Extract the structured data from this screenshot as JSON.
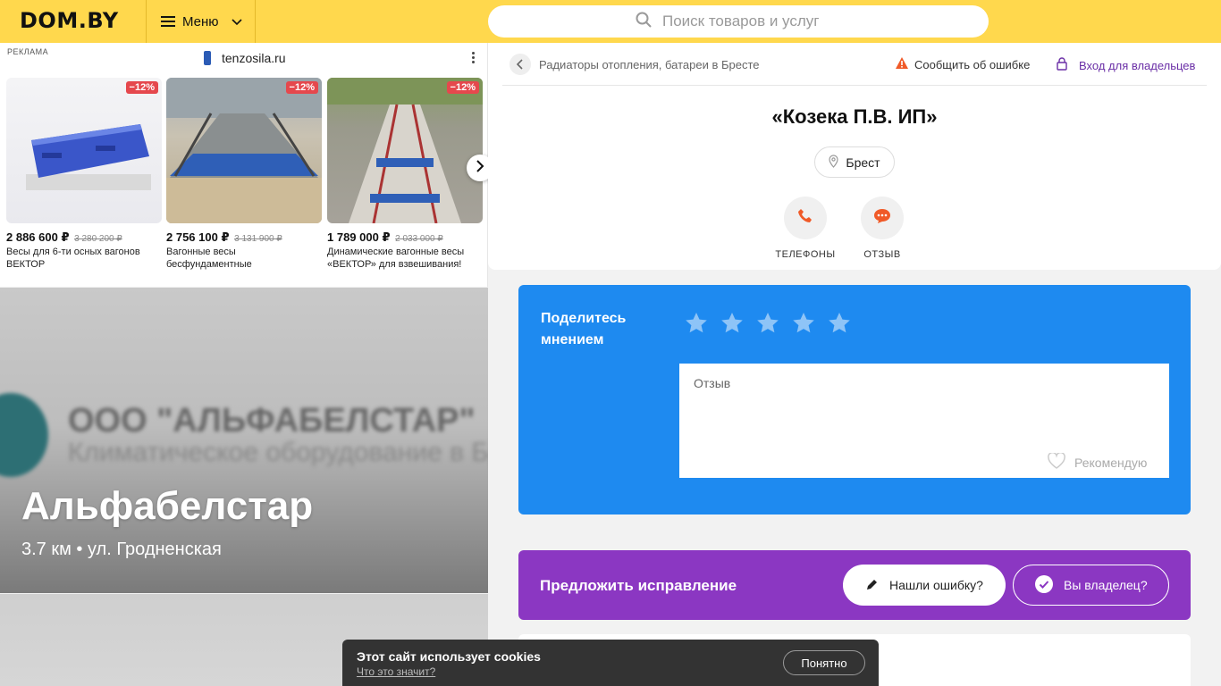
{
  "header": {
    "logo": "DOM.BY",
    "menu_label": "Меню",
    "search_placeholder": "Поиск товаров и услуг"
  },
  "ad": {
    "label": "РЕКЛАМА",
    "domain": "tenzosila.ru",
    "items": [
      {
        "badge": "−12%",
        "price": "2 886 600 ₽",
        "old_price": "3 280 200 ₽",
        "desc": "Весы для 6-ти осных вагонов ВЕКТОР"
      },
      {
        "badge": "−12%",
        "price": "2 756 100 ₽",
        "old_price": "3 131 900 ₽",
        "desc": "Вагонные весы бесфундаментные"
      },
      {
        "badge": "−12%",
        "price": "1 789 000 ₽",
        "old_price": "2 033 000 ₽",
        "desc": "Динамические вагонные весы «ВЕКТОР» для взвешивания!"
      }
    ]
  },
  "promo": {
    "blurred_line1": "ООО \"АЛЬФАБЕЛСТАР\"",
    "blurred_line2": "Климатическое оборудование в Бресте",
    "title": "Альфабелстар",
    "subtitle": "3.7 км • ул. Гродненская"
  },
  "company": {
    "breadcrumb": "Радиаторы отопления, батареи в Бресте",
    "report_error": "Сообщить об ошибке",
    "owner_login": "Вход для владельцев",
    "name": "«Козека П.В. ИП»",
    "city": "Брест",
    "actions": {
      "phones": "ТЕЛЕФОНЫ",
      "review": "ОТЗЫВ"
    }
  },
  "review": {
    "heading": "Поделитесь мнением",
    "stars": 5,
    "textarea_placeholder": "Отзыв",
    "recommend": "Рекомендую"
  },
  "suggest": {
    "title": "Предложить исправление",
    "found_error": "Нашли ошибку?",
    "are_owner": "Вы владелец?"
  },
  "cookie": {
    "text": "Этот сайт использует cookies",
    "link": "Что это значит?",
    "ok": "Понятно"
  },
  "colors": {
    "header_bg": "#ffd84d",
    "review_bg": "#1e8af0",
    "suggest_bg": "#8b37c2",
    "accent_orange": "#f05a28",
    "badge_red": "#e5484d"
  }
}
